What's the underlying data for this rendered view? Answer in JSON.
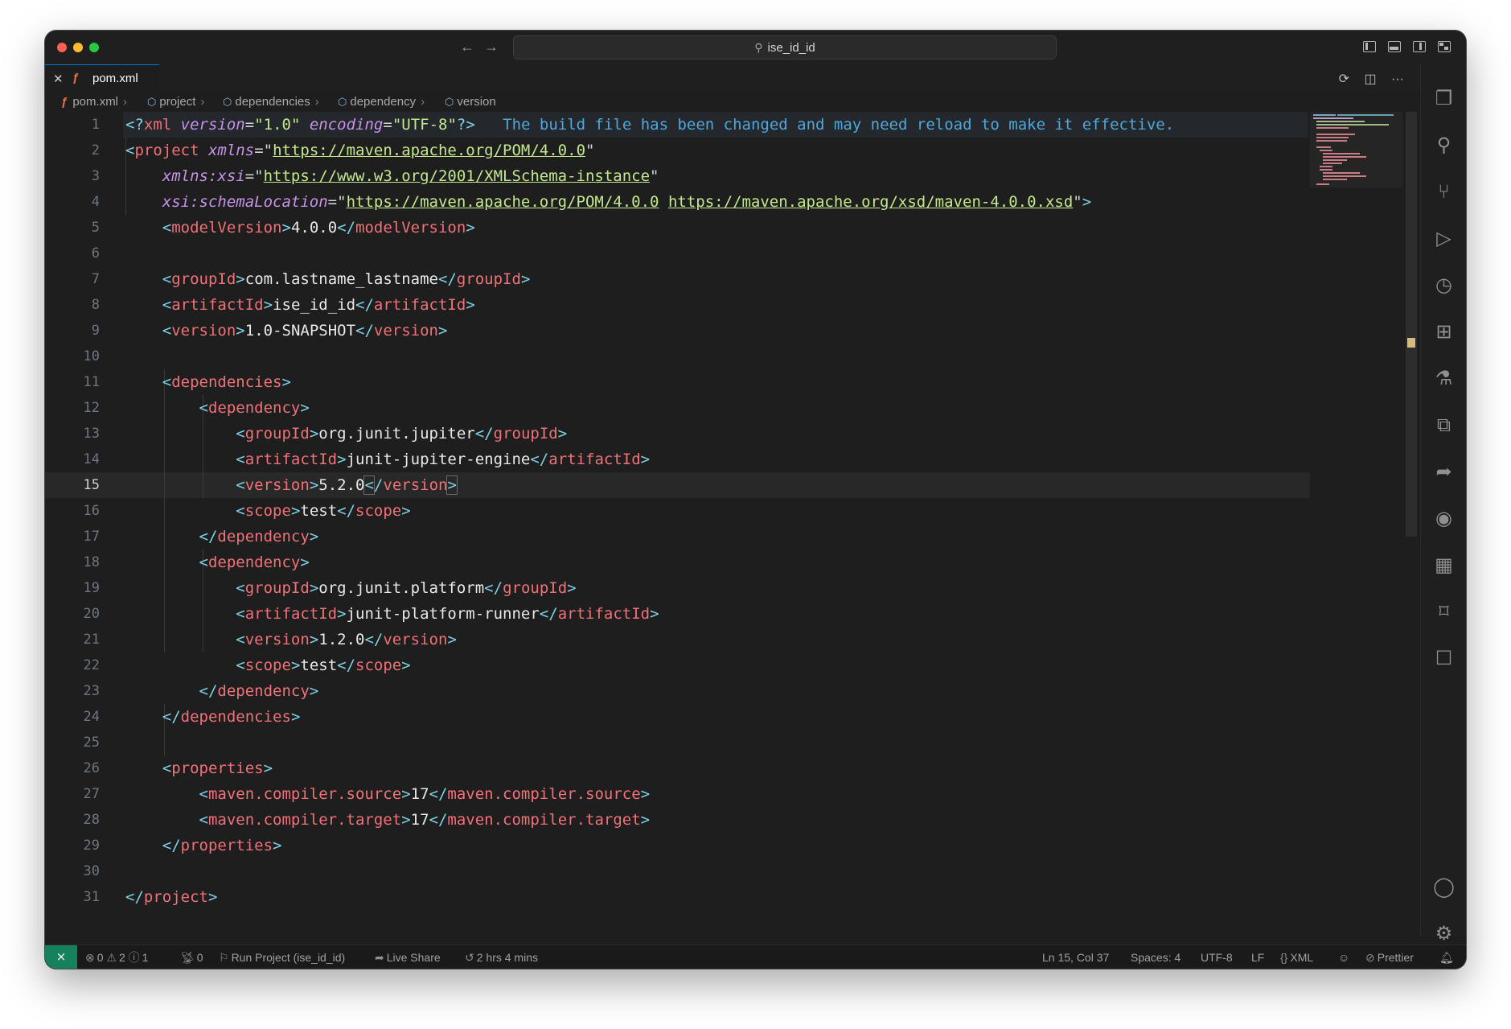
{
  "window": {
    "search_text": "ise_id_id"
  },
  "tab": {
    "filename": "pom.xml"
  },
  "breadcrumbs": [
    "pom.xml",
    "project",
    "dependencies",
    "dependency",
    "version"
  ],
  "editor": {
    "active_line": 15,
    "line_numbers": [
      "1",
      "2",
      "3",
      "4",
      "5",
      "6",
      "7",
      "8",
      "9",
      "10",
      "11",
      "12",
      "13",
      "14",
      "15",
      "16",
      "17",
      "18",
      "19",
      "20",
      "21",
      "22",
      "23",
      "24",
      "25",
      "26",
      "27",
      "28",
      "29",
      "30",
      "31"
    ],
    "reload_hint": "The build file has been changed and may need reload to make it effective.",
    "xml_decl": {
      "name": "xml",
      "version_attr": "version",
      "version_val": "\"1.0\"",
      "encoding_attr": "encoding",
      "encoding_val": "\"UTF-8\""
    },
    "project": {
      "tag": "project",
      "xmlns_attr": "xmlns",
      "xmlns_url": "https://maven.apache.org/POM/4.0.0",
      "xsi_attr": "xmlns:xsi",
      "xsi_url": "https://www.w3.org/2001/XMLSchema-instance",
      "schema_attr": "xsi:schemaLocation",
      "schema_url1": "https://maven.apache.org/POM/4.0.0",
      "schema_url2": "https://maven.apache.org/xsd/maven-4.0.0.xsd"
    },
    "model_version": {
      "tag": "modelVersion",
      "value": "4.0.0"
    },
    "group_id": {
      "tag": "groupId",
      "value": "com.lastname_lastname"
    },
    "artifact_id": {
      "tag": "artifactId",
      "value": "ise_id_id"
    },
    "version": {
      "tag": "version",
      "value": "1.0-SNAPSHOT"
    },
    "dependencies_tag": "dependencies",
    "dependency_tag": "dependency",
    "dependency_list": [
      {
        "group_tag": "groupId",
        "group": "org.junit.jupiter",
        "artifact_tag": "artifactId",
        "artifact": "junit-jupiter-engine",
        "version_tag": "version",
        "version": "5.2.0",
        "scope_tag": "scope",
        "scope": "test"
      },
      {
        "group_tag": "groupId",
        "group": "org.junit.platform",
        "artifact_tag": "artifactId",
        "artifact": "junit-platform-runner",
        "version_tag": "version",
        "version": "1.2.0",
        "scope_tag": "scope",
        "scope": "test"
      }
    ],
    "properties_tag": "properties",
    "compiler_source": {
      "tag": "maven.compiler.source",
      "value": "17"
    },
    "compiler_target": {
      "tag": "maven.compiler.target",
      "value": "17"
    }
  },
  "statusbar": {
    "errors": "0",
    "warnings": "2",
    "infos": "1",
    "ports": "0",
    "run_project": "Run Project (ise_id_id)",
    "live_share": "Live Share",
    "time_tracked": "2 hrs 4 mins",
    "cursor_position": "Ln 15, Col 37",
    "spaces": "Spaces: 4",
    "encoding": "UTF-8",
    "eol": "LF",
    "language": "XML",
    "formatter": "Prettier"
  },
  "icons": {
    "activity": [
      "explorer-icon",
      "search-icon",
      "source-control-icon",
      "run-debug-icon",
      "timeline-icon",
      "extensions-icon",
      "testing-icon",
      "remote-explorer-icon",
      "live-share-icon",
      "github-icon",
      "docker-icon",
      "bookmarks-icon",
      "comments-icon",
      "account-icon",
      "settings-gear-icon"
    ]
  },
  "colors": {
    "editor_bg": "#1e1e1e",
    "tag": "#f07178",
    "bracket": "#7fd0e5",
    "attribute": "#c792ea",
    "string": "#c3e88d",
    "hint": "#4ea8de",
    "remote_badge": "#16825d"
  }
}
